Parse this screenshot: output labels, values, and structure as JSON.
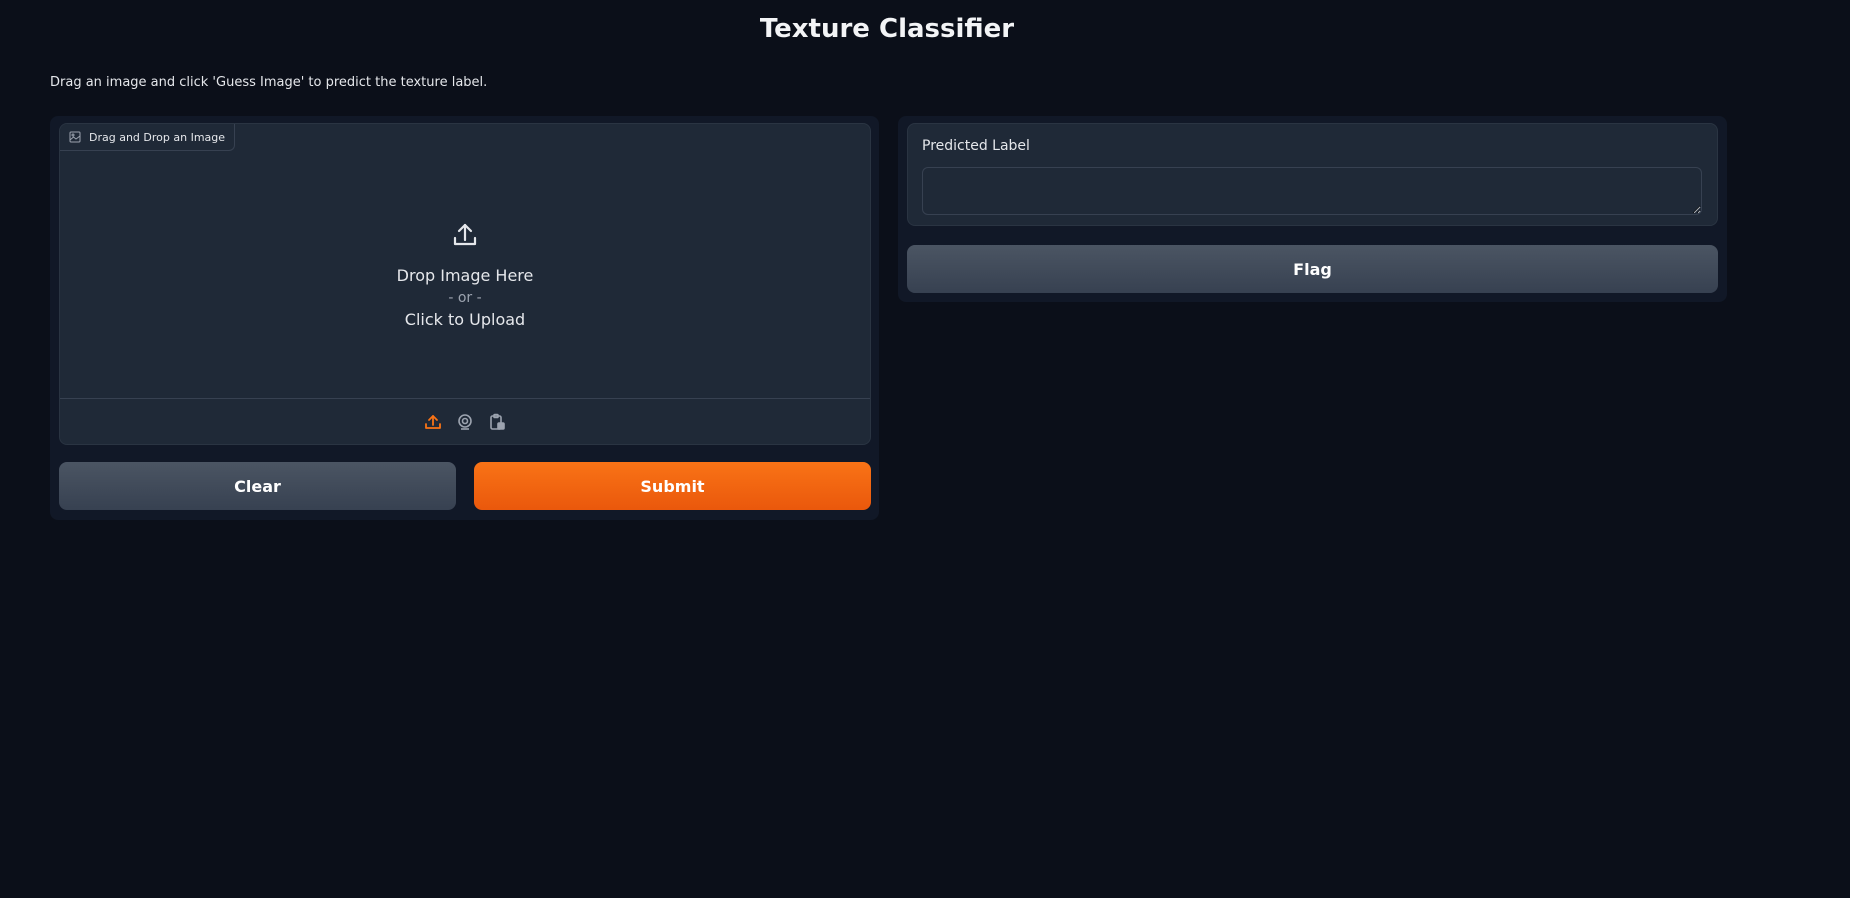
{
  "app": {
    "title": "Texture Classifier",
    "description": "Drag an image and click 'Guess Image' to predict the texture label."
  },
  "input": {
    "block_label": "Drag and Drop an Image",
    "label_icon": "image-icon",
    "drop_icon": "upload-icon",
    "drop_text": "Drop Image Here",
    "or_text": "- or -",
    "click_text": "Click to Upload",
    "sources": [
      {
        "name": "upload-source-icon",
        "active": true
      },
      {
        "name": "webcam-source-icon",
        "active": false
      },
      {
        "name": "clipboard-source-icon",
        "active": false
      }
    ]
  },
  "buttons": {
    "clear_label": "Clear",
    "submit_label": "Submit",
    "flag_label": "Flag"
  },
  "output": {
    "label": "Predicted Label",
    "value": ""
  },
  "colors": {
    "background": "#0b0f19",
    "panel": "#111827",
    "block": "#1f2937",
    "accent": "#f97316",
    "secondary_button": "#4b5563"
  }
}
